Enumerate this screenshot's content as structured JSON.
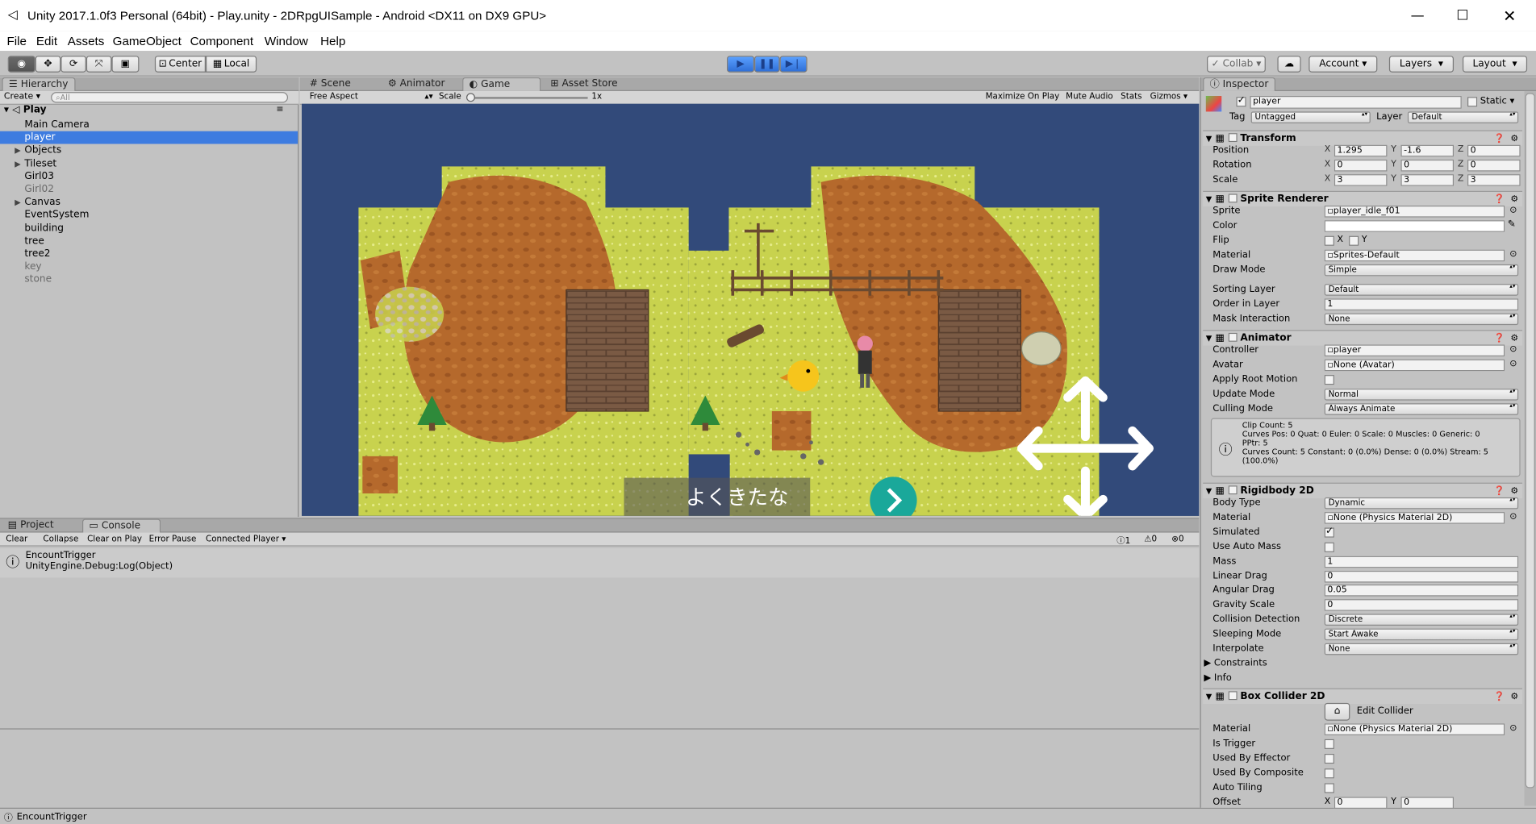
{
  "window": {
    "title": "Unity 2017.1.0f3 Personal (64bit) - Play.unity - 2DRpgUISample - Android <DX11 on DX9 GPU>"
  },
  "menu": [
    "File",
    "Edit",
    "Assets",
    "GameObject",
    "Component",
    "Window",
    "Help"
  ],
  "toolbar": {
    "center": "Center",
    "local": "Local",
    "collab": "Collab",
    "account": "Account",
    "layers": "Layers",
    "layout": "Layout"
  },
  "hierarchy": {
    "tab": "Hierarchy",
    "create": "Create",
    "search_placeholder": "All",
    "scene": "Play",
    "items": [
      {
        "label": "Main Camera",
        "dim": false,
        "foldout": false
      },
      {
        "label": "player",
        "dim": false,
        "foldout": false,
        "selected": true
      },
      {
        "label": "Objects",
        "dim": false,
        "foldout": true
      },
      {
        "label": "Tileset",
        "dim": false,
        "foldout": true
      },
      {
        "label": "Girl03",
        "dim": false,
        "foldout": false
      },
      {
        "label": "Girl02",
        "dim": true,
        "foldout": false
      },
      {
        "label": "Canvas",
        "dim": false,
        "foldout": true
      },
      {
        "label": "EventSystem",
        "dim": false,
        "foldout": false
      },
      {
        "label": "building",
        "dim": false,
        "foldout": false
      },
      {
        "label": "tree",
        "dim": false,
        "foldout": false
      },
      {
        "label": "tree2",
        "dim": false,
        "foldout": false
      },
      {
        "label": "key",
        "dim": true,
        "foldout": false
      },
      {
        "label": "stone",
        "dim": true,
        "foldout": false
      }
    ]
  },
  "view_tabs": [
    "Scene",
    "Animator",
    "Game",
    "Asset Store"
  ],
  "game_bar": {
    "aspect": "Free Aspect",
    "scale_label": "Scale",
    "scale_value": "1x",
    "maximize": "Maximize On Play",
    "mute": "Mute Audio",
    "stats": "Stats",
    "gizmos": "Gizmos"
  },
  "game": {
    "dialog_text": "よくきたな"
  },
  "console": {
    "tabs": [
      "Project",
      "Console"
    ],
    "buttons": [
      "Clear",
      "Collapse",
      "Clear on Play",
      "Error Pause",
      "Connected Player"
    ],
    "counts": [
      "1",
      "0",
      "0"
    ],
    "log_line1": "EncountTrigger",
    "log_line2": "UnityEngine.Debug:Log(Object)",
    "status": "EncountTrigger"
  },
  "inspector": {
    "tab": "Inspector",
    "name": "player",
    "static": "Static",
    "tag_label": "Tag",
    "tag": "Untagged",
    "layer_label": "Layer",
    "layer": "Default",
    "transform": {
      "title": "Transform",
      "position": "Position",
      "pos_x": "1.295",
      "pos_y": "-1.6",
      "pos_z": "0",
      "rotation": "Rotation",
      "rot_x": "0",
      "rot_y": "0",
      "rot_z": "0",
      "scale": "Scale",
      "sc_x": "3",
      "sc_y": "3",
      "sc_z": "3"
    },
    "sprite_renderer": {
      "title": "Sprite Renderer",
      "sprite_label": "Sprite",
      "sprite": "player_idle_f01",
      "color_label": "Color",
      "flip_label": "Flip",
      "flip_x": "X",
      "flip_y": "Y",
      "material_label": "Material",
      "material": "Sprites-Default",
      "draw_mode_label": "Draw Mode",
      "draw_mode": "Simple",
      "sorting_layer_label": "Sorting Layer",
      "sorting_layer": "Default",
      "order_label": "Order in Layer",
      "order": "1",
      "mask_label": "Mask Interaction",
      "mask": "None"
    },
    "animator": {
      "title": "Animator",
      "controller_label": "Controller",
      "controller": "player",
      "avatar_label": "Avatar",
      "avatar": "None (Avatar)",
      "root_motion_label": "Apply Root Motion",
      "update_label": "Update Mode",
      "update": "Normal",
      "culling_label": "Culling Mode",
      "culling": "Always Animate",
      "info1": "Clip Count: 5",
      "info2": "Curves Pos: 0 Quat: 0 Euler: 0 Scale: 0 Muscles: 0 Generic: 0",
      "info3": "PPtr: 5",
      "info4": "Curves Count: 5 Constant: 0 (0.0%) Dense: 0 (0.0%) Stream: 5",
      "info5": "(100.0%)"
    },
    "rigidbody": {
      "title": "Rigidbody 2D",
      "body_type_label": "Body Type",
      "body_type": "Dynamic",
      "material_label": "Material",
      "material": "None (Physics Material 2D)",
      "simulated_label": "Simulated",
      "auto_mass_label": "Use Auto Mass",
      "mass_label": "Mass",
      "mass": "1",
      "linear_label": "Linear Drag",
      "linear": "0",
      "angular_label": "Angular Drag",
      "angular": "0.05",
      "gravity_label": "Gravity Scale",
      "gravity": "0",
      "collision_label": "Collision Detection",
      "collision": "Discrete",
      "sleeping_label": "Sleeping Mode",
      "sleeping": "Start Awake",
      "interpolate_label": "Interpolate",
      "interpolate": "None",
      "constraints_label": "Constraints",
      "info_label": "Info"
    },
    "box_collider": {
      "title": "Box Collider 2D",
      "edit_label": "Edit Collider",
      "material_label": "Material",
      "material": "None (Physics Material 2D)",
      "trigger_label": "Is Trigger",
      "effector_label": "Used By Effector",
      "composite_label": "Used By Composite",
      "tiling_label": "Auto Tiling",
      "offset_label": "Offset",
      "off_x": "0",
      "off_y": "0"
    }
  },
  "colors": {
    "selection": "#3e7ce0",
    "game_bg": "#324a7a",
    "grass": "#c5cf4a",
    "dirt": "#b0662a",
    "dialog_button": "#1aa89a"
  }
}
